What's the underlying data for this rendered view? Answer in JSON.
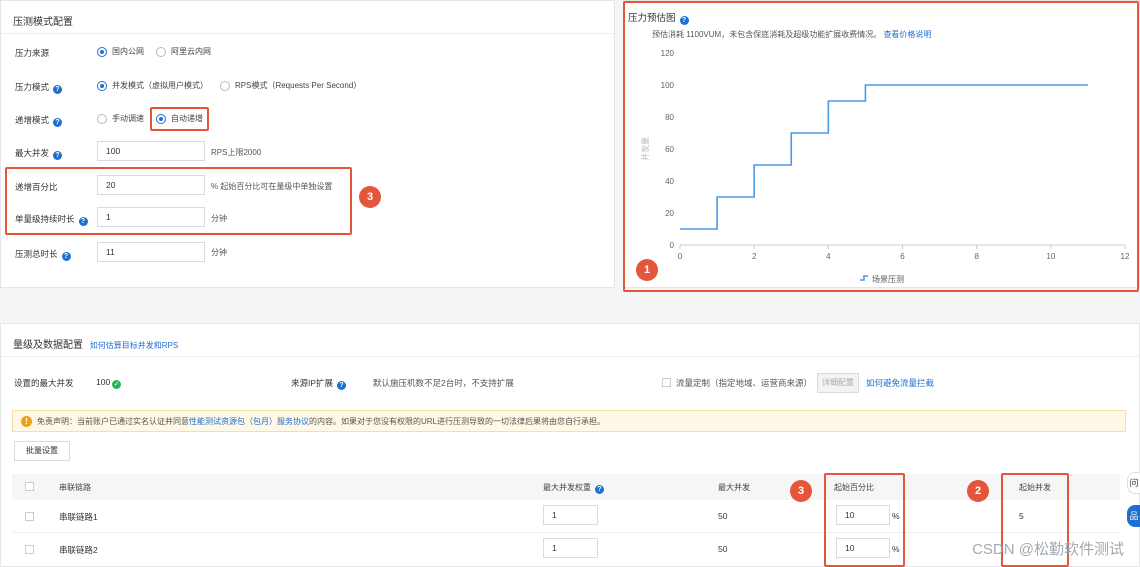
{
  "pressure_config": {
    "title": "压测模式配置",
    "source": {
      "label": "压力来源",
      "options": [
        "国内公网",
        "阿里云内网"
      ],
      "selected": 0
    },
    "mode": {
      "label": "压力模式",
      "options": [
        "并发模式（虚拟用户模式）",
        "RPS模式（Requests Per Second）"
      ],
      "selected": 0
    },
    "ramp": {
      "label": "递增模式",
      "options": [
        "手动调速",
        "自动递增"
      ],
      "selected": 1
    },
    "max_concurrency": {
      "label": "最大并发",
      "value": "100",
      "hint": "RPS上限2000"
    },
    "ramp_percent": {
      "label": "递增百分比",
      "value": "20",
      "hint": "% 起始百分比可在量级中单独设置"
    },
    "step_duration": {
      "label": "单量级持续时长",
      "value": "1",
      "hint": "分钟"
    },
    "total_duration": {
      "label": "压测总时长",
      "value": "11",
      "hint": "分钟"
    }
  },
  "estimate": {
    "title": "压力预估图",
    "subtitle": "预估消耗 1100VUM，未包含保底消耗及超级功能扩展收费情况。",
    "subtitle_link": "查看价格说明",
    "legend": "场景压测"
  },
  "chart_data": {
    "type": "line",
    "x": [
      0,
      1,
      1,
      2,
      2,
      3,
      3,
      4,
      4,
      5,
      5,
      11
    ],
    "series": [
      {
        "name": "场景压测",
        "values": [
          10,
          10,
          30,
          30,
          50,
          50,
          70,
          70,
          90,
          90,
          100,
          100
        ]
      }
    ],
    "ylabel": "并发量",
    "xlim": [
      0,
      12
    ],
    "ylim": [
      0,
      120
    ],
    "xticks": [
      "0",
      "2",
      "4",
      "6",
      "8",
      "10",
      "12"
    ],
    "yticks": [
      "0",
      "20",
      "40",
      "60",
      "80",
      "100",
      "120"
    ],
    "grid": false,
    "legend_position": "bottom",
    "color": "#4a9ae8"
  },
  "level_config": {
    "title": "量级及数据配置",
    "title_link": "如何估算目标并发和RPS",
    "max_concurrency_label": "设置的最大并发",
    "max_concurrency_value": "100",
    "ip_expand_label": "来源IP扩展",
    "ip_expand_text": "默认施压机数不足2台时，不支持扩展",
    "flow_custom_label": "流量定制（指定地域、运营商来源）",
    "detail_button": "详细配置",
    "flow_link": "如何避免流量拦截",
    "notice": "免责声明：当前账户已通过实名认证并同意",
    "notice_link": "性能测试资源包（包月）服务协议",
    "notice_tail": "的内容。如果对于您没有权限的URL进行压测导致的一切法律后果将由您自行承担。",
    "batch_button": "批量设置",
    "columns": [
      "串联链路",
      "最大并发权重",
      "最大并发",
      "起始百分比",
      "起始并发"
    ],
    "rows": [
      {
        "name": "串联链路1",
        "weight": "1",
        "max": "50",
        "start_percent": "10",
        "start_conc": "5"
      },
      {
        "name": "串联链路2",
        "weight": "1",
        "max": "50",
        "start_percent": "10",
        "start_conc": ""
      }
    ],
    "percent_unit": "%"
  },
  "badges": [
    "1",
    "2",
    "3"
  ],
  "side_tabs": [
    "问",
    "品"
  ],
  "watermark": "CSDN @松勤软件测试"
}
